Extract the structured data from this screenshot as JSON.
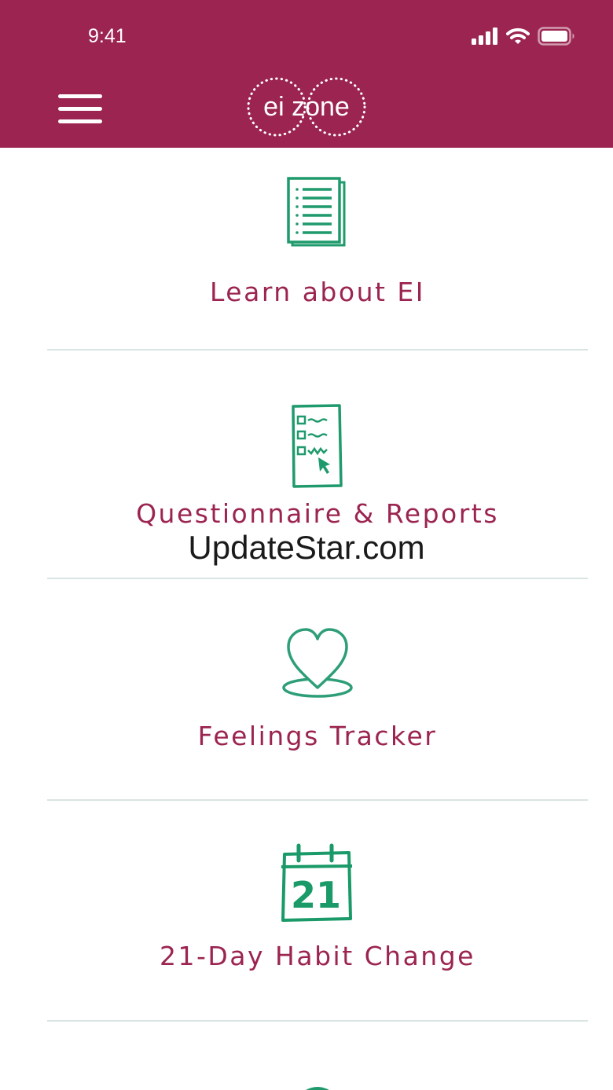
{
  "status_bar": {
    "time": "9:41"
  },
  "header": {
    "brand": "ei zone",
    "menu_icon": "hamburger-menu-icon",
    "background_color": "#9b2450"
  },
  "menu": {
    "items": [
      {
        "label": "Learn about EI",
        "icon": "document-list-icon"
      },
      {
        "label": "Questionnaire & Reports",
        "icon": "checklist-icon"
      },
      {
        "label": "Feelings Tracker",
        "icon": "heart-icon"
      },
      {
        "label": "21-Day Habit Change",
        "icon": "calendar-icon",
        "icon_text": "21"
      }
    ]
  },
  "watermark": "UpdateStar.com",
  "colors": {
    "brand": "#9b2450",
    "icon_green": "#1f9a6c",
    "divider": "#d9e4e3"
  }
}
